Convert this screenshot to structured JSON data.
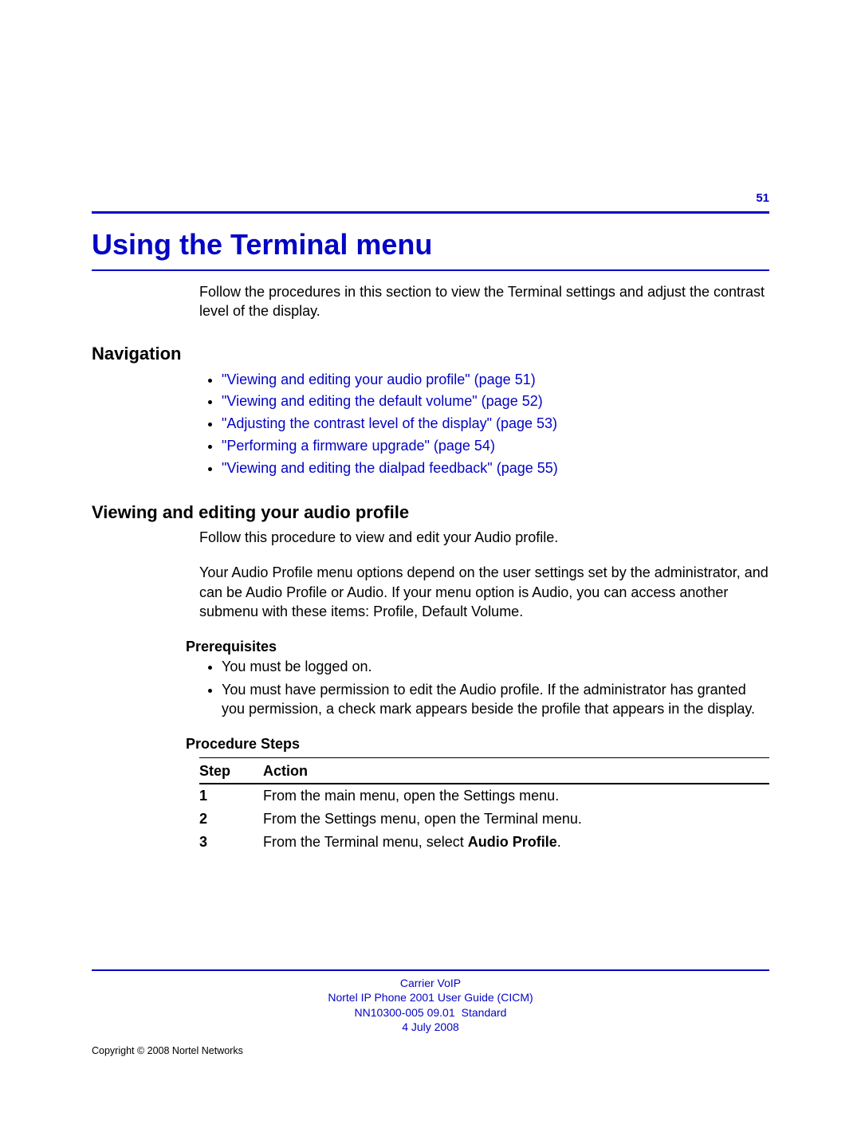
{
  "page_number": "51",
  "title": "Using the Terminal menu",
  "intro": "Follow the procedures in this section to view the Terminal settings and adjust the contrast level of the display.",
  "navigation": {
    "heading": "Navigation",
    "items": [
      "\"Viewing and editing your audio profile\" (page 51)",
      "\"Viewing and editing the default volume\" (page 52)",
      "\"Adjusting the contrast level of the display\" (page 53)",
      "\"Performing a firmware upgrade\" (page 54)",
      "\"Viewing and editing the dialpad feedback\" (page 55)"
    ]
  },
  "section1": {
    "heading": "Viewing and editing your audio profile",
    "intro": "Follow this procedure to view and edit your Audio profile.",
    "para": "Your Audio Profile menu options depend on the user settings set by the administrator, and can be Audio Profile or Audio. If your menu option is Audio, you can access another submenu with these items: Profile, Default Volume.",
    "prereq_heading": "Prerequisites",
    "prereqs": [
      "You must be logged on.",
      "You must have permission to edit the Audio profile. If the administrator has granted you permission, a check mark appears beside the profile that appears in the display."
    ],
    "steps_heading": "Procedure Steps",
    "table_headers": {
      "step": "Step",
      "action": "Action"
    },
    "steps": [
      {
        "n": "1",
        "action_pre": "From the main menu, open the Settings menu.",
        "bold": "",
        "action_post": ""
      },
      {
        "n": "2",
        "action_pre": "From the Settings menu, open the Terminal menu.",
        "bold": "",
        "action_post": ""
      },
      {
        "n": "3",
        "action_pre": "From the Terminal menu, select ",
        "bold": "Audio Profile",
        "action_post": "."
      }
    ]
  },
  "footer": {
    "line1": "Carrier VoIP",
    "line2": "Nortel IP Phone 2001 User Guide (CICM)",
    "line3a": "NN10300-005   09.01",
    "line3b": "Standard",
    "line4": "4 July 2008",
    "copyright": "Copyright © 2008 Nortel Networks"
  }
}
